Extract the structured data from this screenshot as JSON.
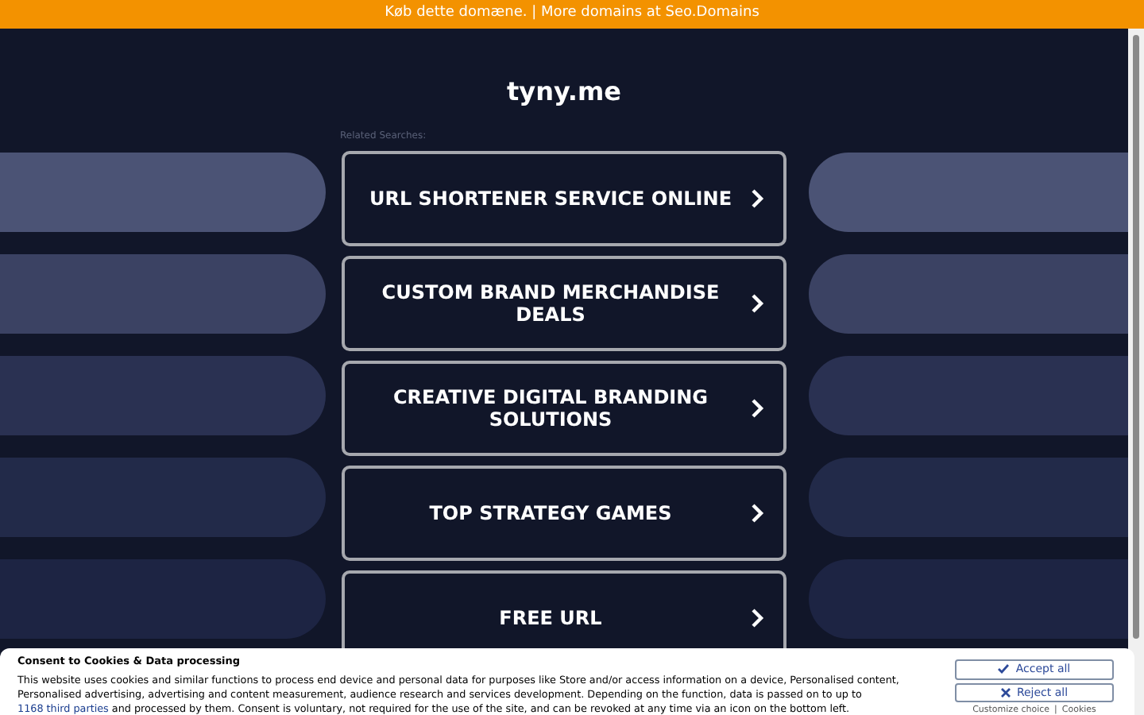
{
  "banner": {
    "text": "Køb dette domæne. | More domains at Seo.Domains"
  },
  "site_title": "tyny.me",
  "related_label": "Related Searches:",
  "searches": [
    {
      "label": "URL SHORTENER SERVICE ONLINE"
    },
    {
      "label": "CUSTOM BRAND MERCHANDISE DEALS"
    },
    {
      "label": "CREATIVE DIGITAL BRANDING SOLUTIONS"
    },
    {
      "label": "TOP STRATEGY GAMES"
    },
    {
      "label": "FREE URL"
    }
  ],
  "cookie_panel": {
    "title": "Consent to Cookies & Data processing",
    "text_before": "This website uses cookies and similar functions to process end device and personal data for purposes like Store and/or access information on a device, Personalised content, Personalised advertising, advertising and content measurement, audience research and services development. Depending on the function, data is passed on to up to",
    "link": "1168 third parties",
    "text_after": "and processed by them. Consent is voluntary, not required for the use of the site, and can be revoked at any time via an icon on the bottom left.",
    "accept": "Accept all",
    "reject": "Reject all",
    "customize": "Customize choice",
    "separator": "|",
    "cookies": "Cookies"
  }
}
